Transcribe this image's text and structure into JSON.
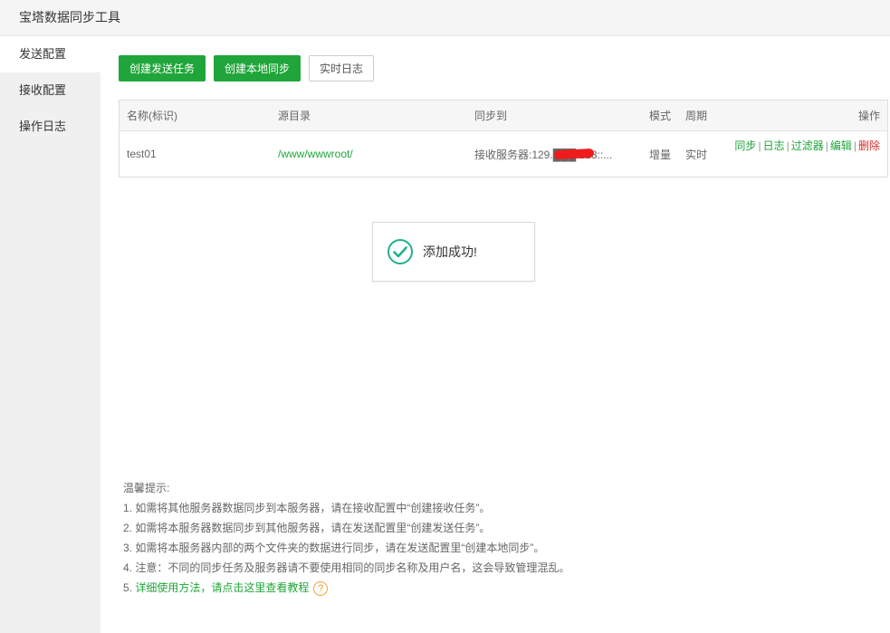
{
  "window": {
    "title": "宝塔数据同步工具"
  },
  "sidebar": {
    "items": [
      {
        "label": "发送配置",
        "active": true
      },
      {
        "label": "接收配置",
        "active": false
      },
      {
        "label": "操作日志",
        "active": false
      }
    ]
  },
  "toolbar": {
    "create_send_task": "创建发送任务",
    "create_local_sync": "创建本地同步",
    "realtime_log": "实时日志"
  },
  "table": {
    "headers": {
      "name": "名称(标识)",
      "source": "源目录",
      "sync_to": "同步到",
      "mode": "模式",
      "period": "周期",
      "ops": "操作"
    },
    "rows": [
      {
        "name": "test01",
        "source": "/www/wwwroot/",
        "sync_to": "接收服务器:129.███.228::...",
        "mode": "增量",
        "period": "实时",
        "ops": {
          "sync": "同步",
          "log": "日志",
          "filter": "过滤器",
          "edit": "编辑",
          "delete": "删除",
          "sep": "|"
        }
      }
    ]
  },
  "toast": {
    "message": "添加成功!"
  },
  "tips": {
    "title": "温馨提示:",
    "lines": [
      "1. 如需将其他服务器数据同步到本服务器，请在接收配置中“创建接收任务”。",
      "2. 如需将本服务器数据同步到其他服务器，请在发送配置里“创建发送任务”。",
      "3. 如需将本服务器内部的两个文件夹的数据进行同步，请在发送配置里“创建本地同步”。",
      "4. 注意：不同的同步任务及服务器请不要使用相同的同步名称及用户名，这会导致管理混乱。"
    ],
    "link_prefix": "5. ",
    "link_text": "详细使用方法，请点击这里查看教程",
    "help_glyph": "?"
  },
  "colors": {
    "accent_green": "#20a53a",
    "delete_red": "#d8302c",
    "help_orange": "#f0a030",
    "success_teal": "#20b28a"
  }
}
